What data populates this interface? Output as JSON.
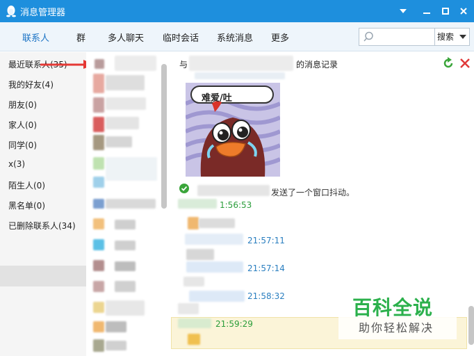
{
  "window": {
    "title": "消息管理器"
  },
  "tabs": [
    {
      "label": "联系人",
      "active": true
    },
    {
      "label": "群"
    },
    {
      "label": "多人聊天"
    },
    {
      "label": "临时会话"
    },
    {
      "label": "系统消息"
    },
    {
      "label": "更多"
    }
  ],
  "search": {
    "placeholder": "",
    "button_label": "搜索"
  },
  "categories": [
    "最近联系人(35)",
    "我的好友(4)",
    "朋友(0)",
    "家人(0)",
    "同学(0)",
    "x(3)",
    "陌生人(0)",
    "黑名单(0)",
    "已删除联系人(34)"
  ],
  "chat": {
    "header_prefix": "与",
    "header_suffix": "的消息记录",
    "sticker_caption": "难爱/吐",
    "shake_notice": "发送了一个窗口抖动。",
    "times": [
      "1:56:53",
      "21:57:11",
      "21:57:14",
      "21:58:32",
      "21:59:29"
    ]
  },
  "watermark": {
    "title": "百科全说",
    "subtitle": "助你轻松解决"
  },
  "colors": {
    "titlebar": "#1e8fdd",
    "accent": "#1b73c5",
    "time_blue": "#2b7fc0",
    "time_green": "#2a9d3a",
    "watermark": "#2bb04b"
  }
}
